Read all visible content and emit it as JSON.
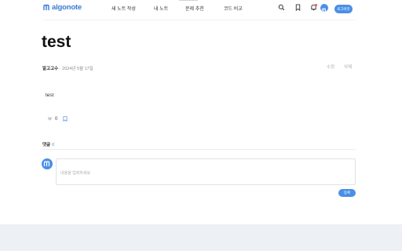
{
  "header": {
    "logo_text": "algonote",
    "nav": [
      "새 노트 작성",
      "내 노트",
      "문제 추천",
      "코드 비교"
    ],
    "logout_label": "로그아웃"
  },
  "post": {
    "title": "test",
    "author": "알고고수",
    "date": "· 2024년 5월 17일",
    "edit_label": "수정",
    "delete_label": "삭제",
    "content": "test",
    "likes": "0"
  },
  "comments": {
    "title": "댓글",
    "count": "0",
    "placeholder": "내용을 입력하세요",
    "submit_label": "등록"
  },
  "colors": {
    "accent": "#4a8fe7",
    "footer": "#edf0f5"
  }
}
